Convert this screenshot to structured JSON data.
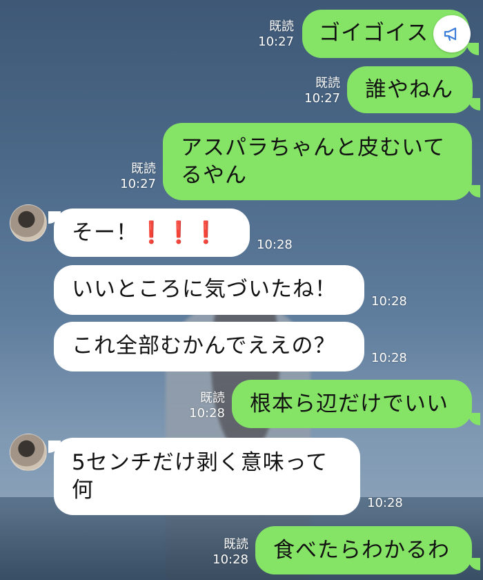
{
  "messages": [
    {
      "text": "ゴイゴイス",
      "read": "既読",
      "time": "10:27"
    },
    {
      "text": "誰やねん",
      "read": "既読",
      "time": "10:27"
    },
    {
      "line1": "アスパラちゃんと皮むいて",
      "line2": "るやん",
      "read": "既読",
      "time": "10:27"
    },
    {
      "text": "そー！",
      "excl": "❗️❗️❗️",
      "time": "10:28"
    },
    {
      "text": "いいところに気づいたね！",
      "time": "10:28"
    },
    {
      "text": "これ全部むかんでええの？",
      "time": "10:28"
    },
    {
      "text": "根本ら辺だけでいい",
      "read": "既読",
      "time": "10:28"
    },
    {
      "line1": "5センチだけ剥く意味って",
      "line2": "何",
      "time": "10:28"
    },
    {
      "text": "食べたらわかるわ",
      "read": "既読",
      "time": "10:28"
    }
  ],
  "icons": {
    "announce": "megaphone-icon",
    "avatar": "contact-avatar"
  },
  "colors": {
    "outgoing": "#85e366",
    "incoming": "#ffffff",
    "alert": "#e11d1d"
  }
}
